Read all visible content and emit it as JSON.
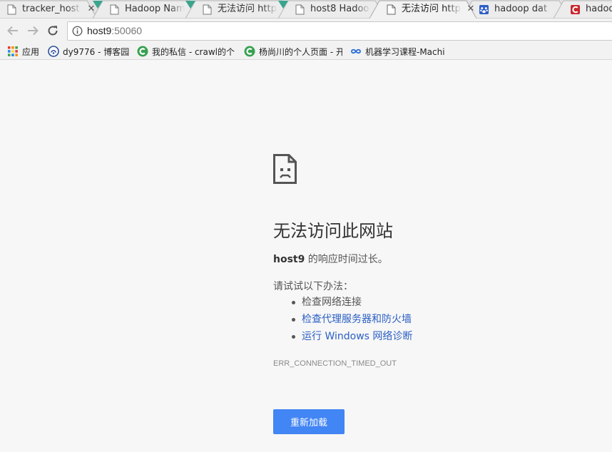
{
  "tabs": [
    {
      "title": "tracker_host",
      "icon": "page-icon",
      "active": false
    },
    {
      "title": "Hadoop NameNode",
      "icon": "page-icon",
      "active": false
    },
    {
      "title": "无法访问 http",
      "icon": "page-icon",
      "active": false
    },
    {
      "title": "host8 Hadoop",
      "icon": "page-icon",
      "active": false
    },
    {
      "title": "无法访问 http",
      "icon": "page-icon",
      "active": true
    },
    {
      "title": "hadoop dat",
      "icon": "paw-icon",
      "active": false
    },
    {
      "title": "hadoo",
      "icon": "csdn-icon",
      "active": false
    }
  ],
  "toolbar": {
    "url_host": "host9",
    "url_port": ":50060"
  },
  "bookmarks": [
    {
      "label": "应用",
      "icon": "apps-grid-icon"
    },
    {
      "label": "dy9776 - 博客园",
      "icon": "cnblogs-icon"
    },
    {
      "label": "我的私信 - crawl的个",
      "icon": "green-c-icon"
    },
    {
      "label": "杨尚川的个人页面 - 开",
      "icon": "green-c-icon"
    },
    {
      "label": "机器学习课程-Machi",
      "icon": "infinity-icon"
    }
  ],
  "error_page": {
    "title": "无法访问此网站",
    "host": "host9",
    "desc_suffix": " 的响应时间过长。",
    "suggest_heading": "请试试以下办法：",
    "suggestions": [
      {
        "text": "检查网络连接",
        "is_link": false
      },
      {
        "text": "检查代理服务器和防火墙",
        "is_link": true
      },
      {
        "text": "运行 Windows 网络诊断",
        "is_link": true
      }
    ],
    "error_code": "ERR_CONNECTION_TIMED_OUT",
    "reload_label": "重新加载"
  },
  "colors": {
    "accent": "#4285f4",
    "link": "#2b5fc4",
    "tab_strip": "#e2e2e2",
    "active_tab": "#f2f2f2"
  }
}
